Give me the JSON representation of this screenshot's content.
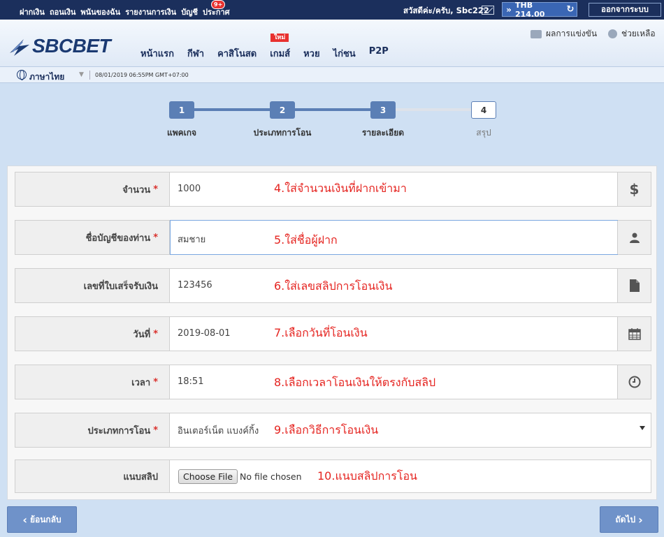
{
  "topbar": {
    "menu": [
      "ฝากเงิน",
      "ถอนเงิน",
      "พนันของฉัน",
      "รายงานการเงิน",
      "บัญชี",
      "ประกาศ"
    ],
    "notice_badge": "9+",
    "greeting": "สวัสดีค่ะ/ครับ, Sbc222",
    "balance": "THB 214.00",
    "logout": "ออกจากระบบ"
  },
  "header": {
    "logo": "SBCBET",
    "nav": [
      "หน้าแรก",
      "กีฬา",
      "คาสิโนสด",
      "เกมส์",
      "หวย",
      "ไก่ชน",
      "P2P"
    ],
    "new_tag": "ใหม่",
    "results": "ผลการแข่งขัน",
    "help": "ช่วยเหลือ"
  },
  "langbar": {
    "language": "ภาษาไทย",
    "datetime": "08/01/2019 06:55PM GMT+07:00"
  },
  "steps": [
    {
      "num": "1",
      "label": "แพคเกจ"
    },
    {
      "num": "2",
      "label": "ประเภทการโอน"
    },
    {
      "num": "3",
      "label": "รายละเอียด"
    },
    {
      "num": "4",
      "label": "สรุป"
    }
  ],
  "form": {
    "amount": {
      "label": "จำนวน",
      "value": "1000",
      "note": "4.ใส่จำนวนเงินที่ฝากเข้ามา"
    },
    "account_name": {
      "label": "ชื่อบัญชีของท่าน",
      "value": "สมชาย",
      "note": "5.ใส่ชื่อผู้ฝาก"
    },
    "receipt_no": {
      "label": "เลขที่ใบเสร็จรับเงิน",
      "value": "123456",
      "note": "6.ใส่เลขสลิปการโอนเงิน"
    },
    "date": {
      "label": "วันที่",
      "value": "2019-08-01",
      "note": "7.เลือกวันที่โอนเงิน"
    },
    "time": {
      "label": "เวลา",
      "value": "18:51",
      "note": "8.เลือกเวลาโอนเงินให้ตรงกับสลิป"
    },
    "transfer_type": {
      "label": "ประเภทการโอน",
      "value": "อินเตอร์เน็ต แบงค์กิ้ง",
      "note": "9.เลือกวิธีการโอนเงิน"
    },
    "attach": {
      "label": "แนบสลิป",
      "button": "Choose File",
      "status": "No file chosen",
      "note": "10.แนบสลิปการโอน"
    },
    "required_mark": "*"
  },
  "buttons": {
    "back": "ย้อนกลับ",
    "next": "ถัดไป"
  },
  "colors": {
    "topbar": "#1b2f5c",
    "accent": "#5b7fb5",
    "note_red": "#e52420"
  }
}
